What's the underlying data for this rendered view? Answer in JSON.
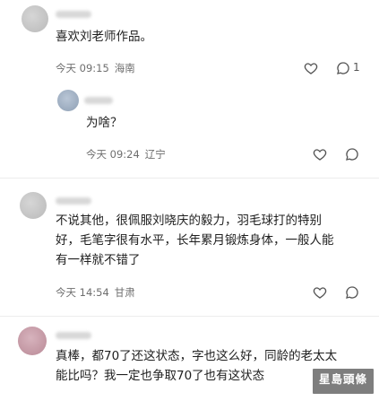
{
  "comments": [
    {
      "text": "喜欢刘老师作品。",
      "time": "今天 09:15",
      "location": "海南",
      "like_count": "",
      "reply_count": "1"
    },
    {
      "text": "为啥？",
      "time": "今天 09:24",
      "location": "辽宁",
      "like_count": "",
      "reply_count": ""
    },
    {
      "text_lines": [
        "不说其他，很佩服刘晓庆的毅力，羽毛球打的特别",
        "好，毛笔字很有水平，长年累月锻炼身体，一般人能",
        "有一样就不错了"
      ],
      "time": "今天 14:54",
      "location": "甘肃",
      "like_count": "",
      "reply_count": ""
    },
    {
      "text_lines": [
        "真棒，都70了还这状态，字也这么好，同龄的老太太",
        "能比吗？我一定也争取70了也有这状态"
      ]
    }
  ],
  "watermark": "星島頭條",
  "icons": {
    "like": "heart-icon",
    "reply": "comment-bubble-icon"
  }
}
